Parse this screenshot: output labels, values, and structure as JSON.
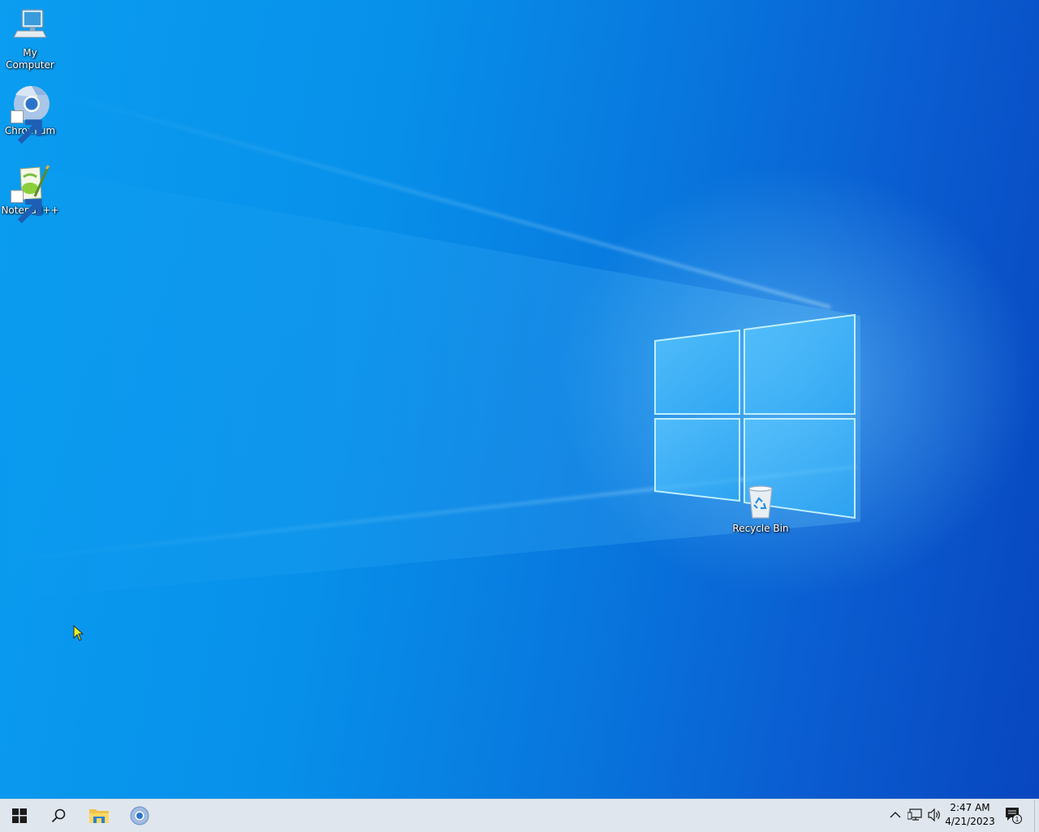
{
  "desktop": {
    "icons": [
      {
        "label": "My\nComputer",
        "icon": "computer-icon"
      },
      {
        "label": "Chromium",
        "icon": "chromium-icon"
      },
      {
        "label": "Notepad++",
        "icon": "notepadpp-icon"
      },
      {
        "label": "Recycle Bin",
        "icon": "recycle-bin-icon"
      }
    ]
  },
  "taskbar": {
    "start": {
      "icon": "windows-start-icon"
    },
    "search": {
      "icon": "search-icon"
    },
    "pinned": [
      {
        "icon": "file-explorer-icon"
      },
      {
        "icon": "chromium-icon"
      }
    ],
    "tray": {
      "icons": [
        "chevron-up-icon",
        "network-icon",
        "volume-icon"
      ],
      "time": "2:47 AM",
      "date": "4/21/2023",
      "notifications": {
        "icon": "action-center-icon",
        "count": "1"
      }
    }
  },
  "colors": {
    "wallpaper_light": "#0a9df0",
    "wallpaper_dark": "#0846bf",
    "taskbar": "#dfe6ee"
  }
}
